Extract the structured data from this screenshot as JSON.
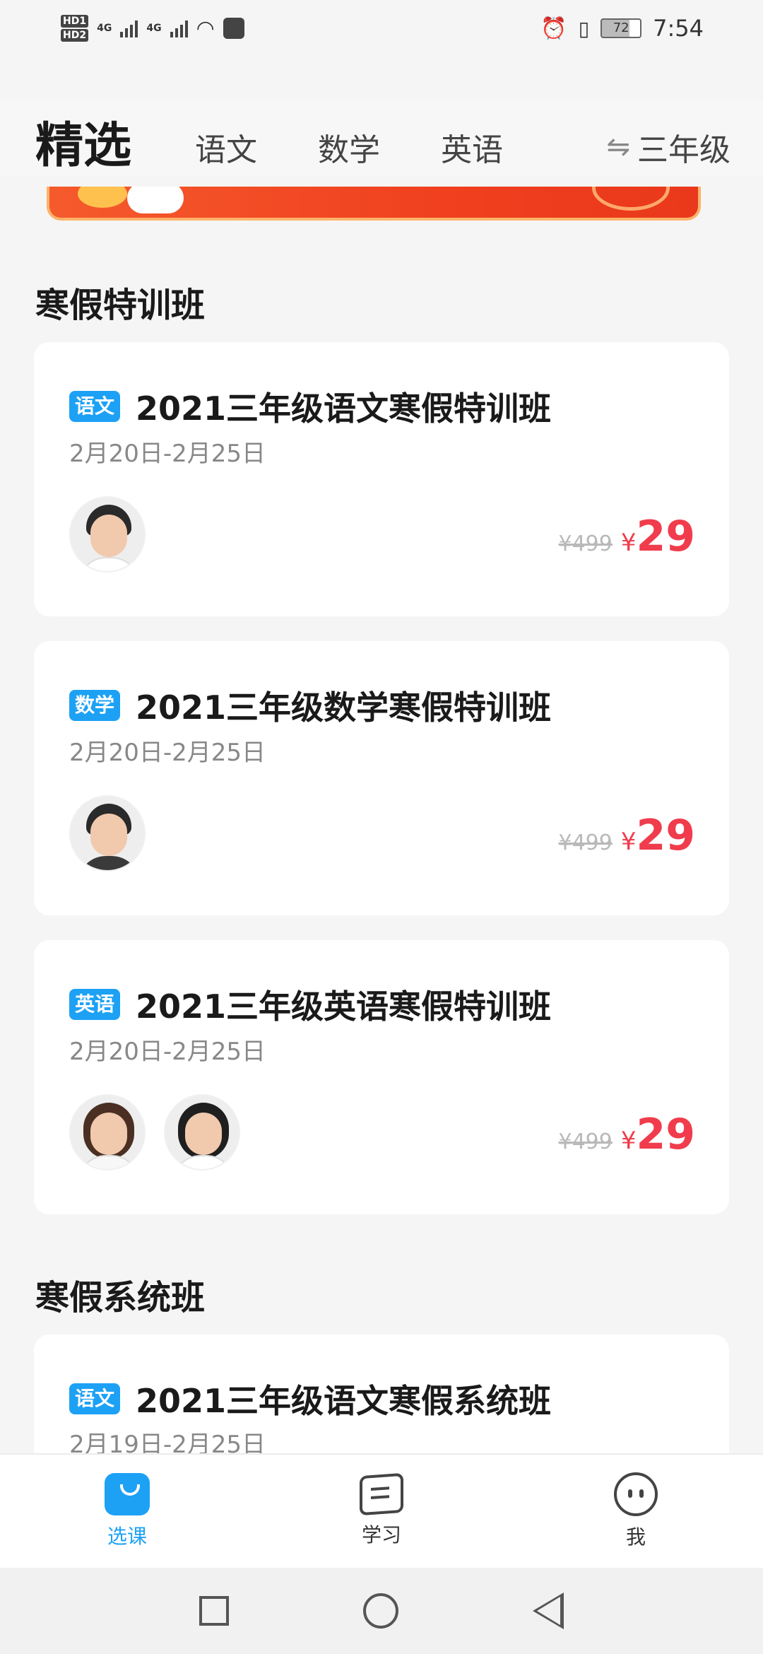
{
  "status_bar": {
    "hd1": "HD1",
    "hd2": "HD2",
    "net1": "4G",
    "net2": "4G",
    "battery": "72",
    "time": "7:54"
  },
  "header": {
    "title": "精选",
    "tabs": [
      "语文",
      "数学",
      "英语"
    ],
    "grade": "三年级",
    "swap_icon": "⇋"
  },
  "sections": [
    {
      "title": "寒假特训班",
      "courses": [
        {
          "tag": "语文",
          "title": "2021三年级语文寒假特训班",
          "date": "2月20日-2月25日",
          "price_old": "¥499",
          "yen": "¥",
          "price_new": "29"
        },
        {
          "tag": "数学",
          "title": "2021三年级数学寒假特训班",
          "date": "2月20日-2月25日",
          "price_old": "¥499",
          "yen": "¥",
          "price_new": "29"
        },
        {
          "tag": "英语",
          "title": "2021三年级英语寒假特训班",
          "date": "2月20日-2月25日",
          "price_old": "¥499",
          "yen": "¥",
          "price_new": "29"
        }
      ]
    },
    {
      "title": "寒假系统班",
      "courses": [
        {
          "tag": "语文",
          "title": "2021三年级语文寒假系统班",
          "date": "2月19日-2月25日"
        }
      ]
    }
  ],
  "bottom_nav": [
    {
      "label": "选课",
      "icon": "shopping-bag-icon",
      "active": true
    },
    {
      "label": "学习",
      "icon": "notebook-icon",
      "active": false
    },
    {
      "label": "我",
      "icon": "profile-face-icon",
      "active": false
    }
  ],
  "colors": {
    "accent": "#1da1f5",
    "price": "#f03c4c",
    "banner": "#f0401f"
  }
}
